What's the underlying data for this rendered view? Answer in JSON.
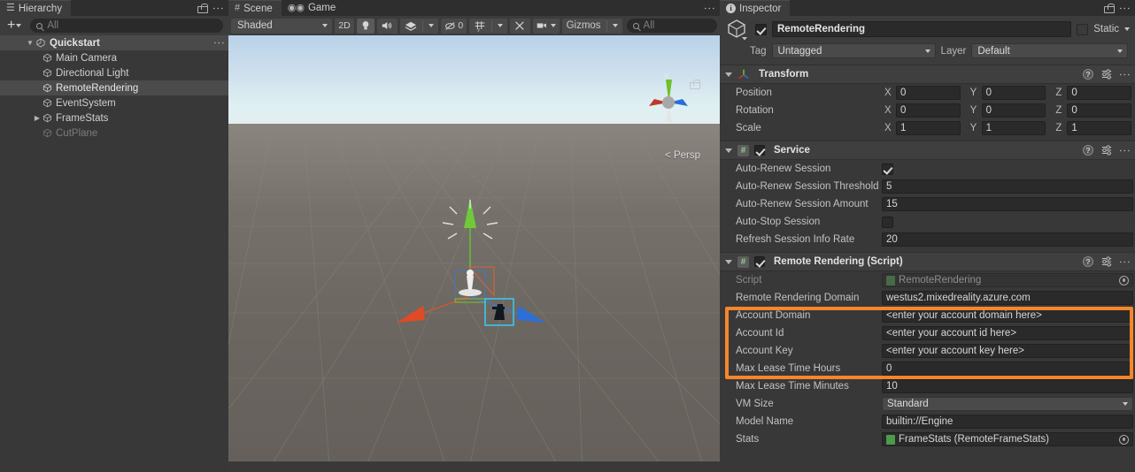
{
  "hierarchy": {
    "tab_label": "Hierarchy",
    "tab_icon": "hierarchy-icon",
    "toolbar": {
      "add_label": "+",
      "search_placeholder": "All"
    },
    "items": [
      {
        "label": "Quickstart",
        "icon": "unity-scene-icon",
        "depth": 0,
        "expanded": true,
        "state": "root"
      },
      {
        "label": "Main Camera",
        "icon": "gameobject-cube-icon",
        "depth": 1,
        "expanded": null,
        "state": "normal"
      },
      {
        "label": "Directional Light",
        "icon": "gameobject-cube-icon",
        "depth": 1,
        "expanded": null,
        "state": "normal"
      },
      {
        "label": "RemoteRendering",
        "icon": "gameobject-cube-icon",
        "depth": 1,
        "expanded": null,
        "state": "selected"
      },
      {
        "label": "EventSystem",
        "icon": "gameobject-cube-icon",
        "depth": 1,
        "expanded": null,
        "state": "normal"
      },
      {
        "label": "FrameStats",
        "icon": "gameobject-cube-icon",
        "depth": 1,
        "expanded": false,
        "state": "normal"
      },
      {
        "label": "CutPlane",
        "icon": "gameobject-cube-icon",
        "depth": 1,
        "expanded": null,
        "state": "disabled"
      }
    ]
  },
  "scene": {
    "tabs": [
      {
        "label": "Scene",
        "icon": "scene-hash-icon",
        "active": true
      },
      {
        "label": "Game",
        "icon": "gamepad-icon",
        "active": false
      }
    ],
    "toolbar": {
      "draw_mode": "Shaded",
      "mode_2d": "2D",
      "lighting_icon": "lightbulb-icon",
      "audio_icon": "speaker-icon",
      "fx_icon": "effects-icon",
      "hidden_count": "0",
      "hidden_icon": "eye-off-icon",
      "grid_icon": "grid-icon",
      "tools_icon": "tools-icon",
      "camera_icon": "camera-icon",
      "gizmos_label": "Gizmos",
      "search_placeholder": "All"
    },
    "viewport": {
      "perspective_label": "Persp",
      "gizmo_axes": [
        "x",
        "y",
        "z"
      ],
      "gizmo_colors": {
        "x": "#c0392b",
        "y": "#6fbf2a",
        "z": "#2a6fd8"
      }
    }
  },
  "inspector": {
    "tab_label": "Inspector",
    "tab_icon": "info-icon",
    "gameobject": {
      "enabled": true,
      "name": "RemoteRendering",
      "static_label": "Static",
      "static_checked": false,
      "tag_label": "Tag",
      "tag_value": "Untagged",
      "layer_label": "Layer",
      "layer_value": "Default"
    },
    "components": [
      {
        "title": "Transform",
        "icon": "transform-axis-icon",
        "has_checkbox": false,
        "rows": [
          {
            "type": "vector3",
            "label": "Position",
            "axes": [
              "X",
              "Y",
              "Z"
            ],
            "values": [
              "0",
              "0",
              "0"
            ]
          },
          {
            "type": "vector3",
            "label": "Rotation",
            "axes": [
              "X",
              "Y",
              "Z"
            ],
            "values": [
              "0",
              "0",
              "0"
            ]
          },
          {
            "type": "vector3",
            "label": "Scale",
            "axes": [
              "X",
              "Y",
              "Z"
            ],
            "values": [
              "1",
              "1",
              "1"
            ]
          }
        ]
      },
      {
        "title": "Service",
        "icon": "cs-script-icon",
        "has_checkbox": true,
        "checked": true,
        "rows": [
          {
            "type": "checkbox",
            "label": "Auto-Renew Session",
            "checked": true
          },
          {
            "type": "text",
            "label": "Auto-Renew Session Threshold",
            "value": "5"
          },
          {
            "type": "text",
            "label": "Auto-Renew Session Amount",
            "value": "15"
          },
          {
            "type": "checkbox",
            "label": "Auto-Stop Session",
            "checked": false
          },
          {
            "type": "text",
            "label": "Refresh Session Info Rate",
            "value": "20"
          }
        ]
      },
      {
        "title": "Remote Rendering (Script)",
        "icon": "cs-script-icon",
        "has_checkbox": true,
        "checked": true,
        "rows": [
          {
            "type": "object",
            "label": "Script",
            "value": "RemoteRendering",
            "disabled": true
          },
          {
            "type": "text",
            "label": "Remote Rendering Domain",
            "value": "westus2.mixedreality.azure.com",
            "highlighted": true
          },
          {
            "type": "text",
            "label": "Account Domain",
            "value": "<enter your account domain here>",
            "highlighted": true
          },
          {
            "type": "text",
            "label": "Account Id",
            "value": "<enter your account id here>",
            "highlighted": true
          },
          {
            "type": "text",
            "label": "Account Key",
            "value": "<enter your account key here>",
            "highlighted": true
          },
          {
            "type": "text",
            "label": "Max Lease Time Hours",
            "value": "0"
          },
          {
            "type": "text",
            "label": "Max Lease Time Minutes",
            "value": "10"
          },
          {
            "type": "dropdown",
            "label": "VM Size",
            "value": "Standard"
          },
          {
            "type": "text",
            "label": "Model Name",
            "value": "builtin://Engine"
          },
          {
            "type": "object",
            "label": "Stats",
            "value": "FrameStats (RemoteFrameStats)",
            "disabled": false
          }
        ]
      }
    ]
  },
  "colors": {
    "highlight": "#f5862a",
    "panel_bg": "#383838",
    "toolbar_bg": "#3c3c3c",
    "field_bg": "#2a2a2a",
    "selection": "#4b4b4b"
  }
}
